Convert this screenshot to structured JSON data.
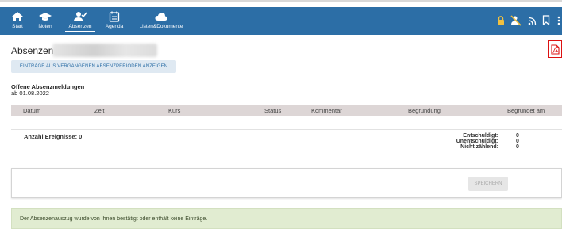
{
  "nav": {
    "items": [
      {
        "label": "Start",
        "icon": "home-icon"
      },
      {
        "label": "Noten",
        "icon": "graduation-cap-icon"
      },
      {
        "label": "Absenzen",
        "icon": "user-check-icon"
      },
      {
        "label": "Agenda",
        "icon": "calendar-icon"
      },
      {
        "label": "Listen&Dokumente",
        "icon": "cloud-icon"
      }
    ],
    "active_index": 2,
    "right_icons": [
      "lock-icon",
      "absent-user-icon",
      "wifi-signal-icon",
      "bookmark-icon"
    ]
  },
  "page": {
    "title": "Absenzen -",
    "past_periods_button": "EINTRÄGE AUS VERGANGENEN ABSENZPERIODEN ANZEIGEN",
    "pdf_icon": "pdf-icon"
  },
  "open": {
    "title": "Offene Absenzmeldungen",
    "subtitle": "ab 01.08.2022"
  },
  "table": {
    "columns": [
      "Datum",
      "Zeit",
      "Kurs",
      "Status",
      "Kommentar",
      "Begründung",
      "Begründet am"
    ],
    "events_label": "Anzahl Ereignisse: 0",
    "summary": [
      {
        "label": "Entschuldigt:",
        "value": "0"
      },
      {
        "label": "Unentschuldigt:",
        "value": "0"
      },
      {
        "label": "Nicht zählend:",
        "value": "0"
      }
    ]
  },
  "save": {
    "label": "SPEICHERN"
  },
  "info": {
    "text": "Der Absenzenauszug wurde von Ihnen bestätigt oder enthält keine Einträge."
  },
  "colors": {
    "navbar": "#2c6ea6",
    "header_row": "#ddd6d6",
    "info_bg": "#e1ecd1",
    "pdf_red": "#dd1111"
  }
}
